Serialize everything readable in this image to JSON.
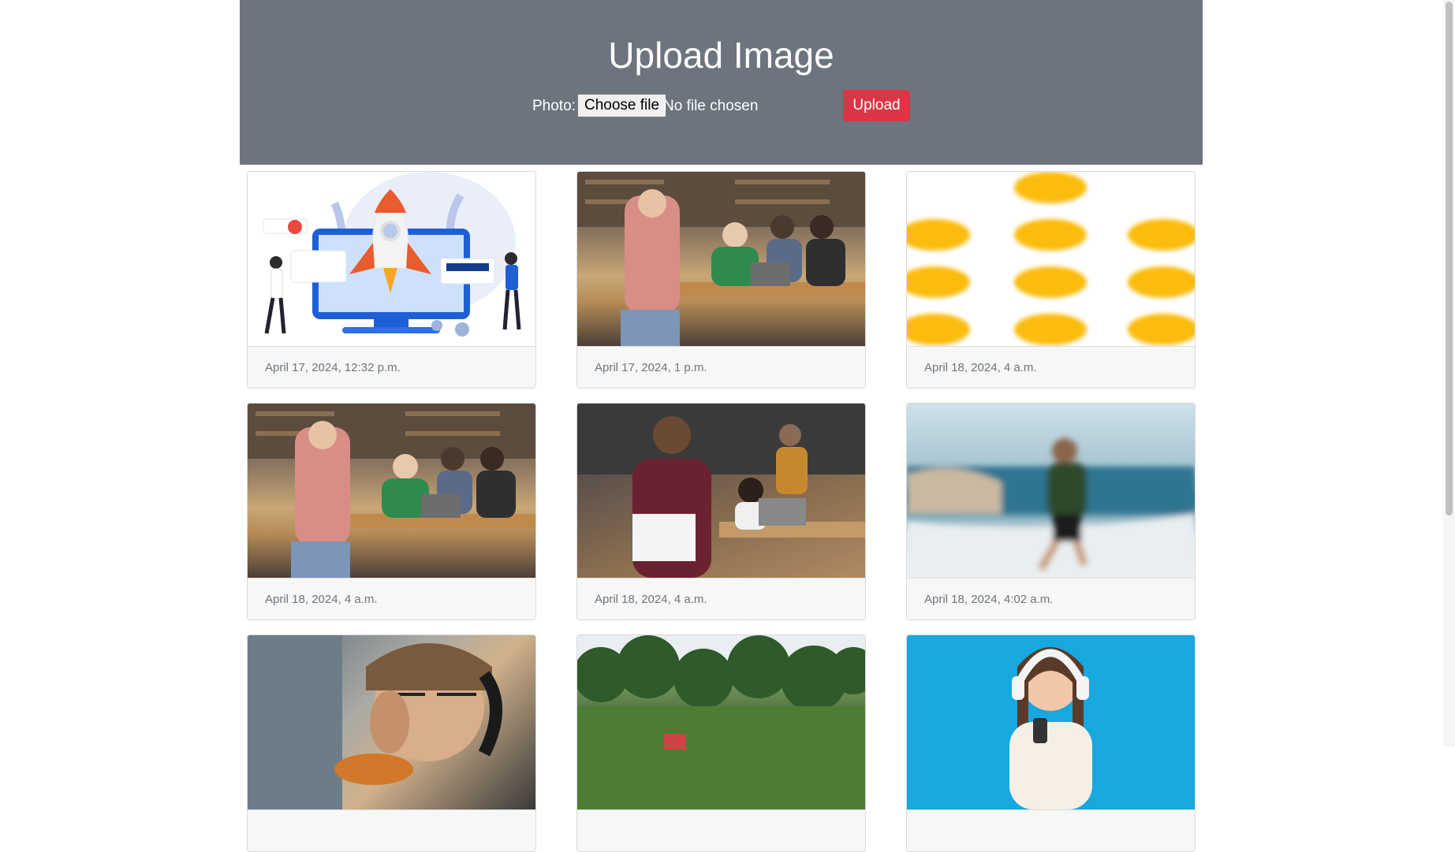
{
  "header": {
    "title": "Upload Image",
    "photo_label": "Photo:",
    "choose_file": "Choose file",
    "file_status": "No file chosen",
    "upload_label": "Upload"
  },
  "colors": {
    "header_bg": "#6c757d",
    "upload_button": "#dc3545"
  },
  "gallery": [
    {
      "date": "April 17, 2024, 12:32 p.m.",
      "image": "rocket-illustration"
    },
    {
      "date": "April 17, 2024, 1 p.m.",
      "image": "students-at-table"
    },
    {
      "date": "April 18, 2024, 4 a.m.",
      "image": "yellow-dots-pattern"
    },
    {
      "date": "April 18, 2024, 4 a.m.",
      "image": "students-at-table"
    },
    {
      "date": "April 18, 2024, 4 a.m.",
      "image": "office-meeting"
    },
    {
      "date": "April 18, 2024, 4:02 a.m.",
      "image": "hiker-on-cliff"
    },
    {
      "date": "",
      "image": "man-with-headphones"
    },
    {
      "date": "",
      "image": "park-landscape"
    },
    {
      "date": "",
      "image": "woman-with-headphones"
    }
  ]
}
